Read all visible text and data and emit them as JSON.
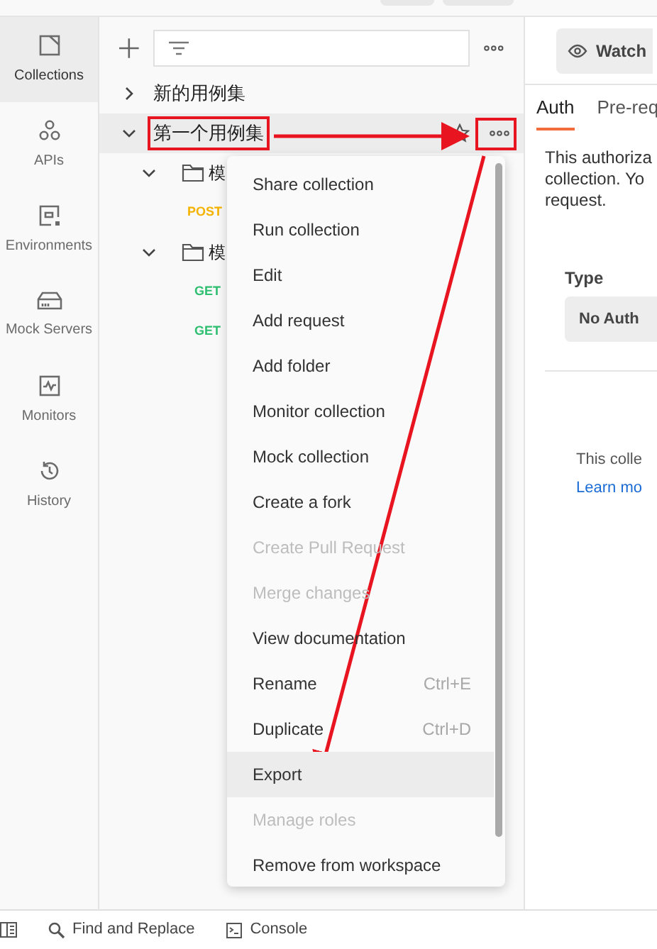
{
  "sidebar": {
    "items": [
      {
        "label": "Collections",
        "selected": true
      },
      {
        "label": "APIs",
        "selected": false
      },
      {
        "label": "Environments",
        "selected": false
      },
      {
        "label": "Mock Servers",
        "selected": false
      },
      {
        "label": "Monitors",
        "selected": false
      },
      {
        "label": "History",
        "selected": false
      }
    ]
  },
  "collections": {
    "tree": [
      {
        "kind": "collection",
        "name": "新的用例集",
        "expanded": false,
        "selected": false
      },
      {
        "kind": "collection",
        "name": "第一个用例集",
        "expanded": true,
        "selected": true,
        "children": [
          {
            "kind": "folder",
            "name": "模",
            "expanded": true,
            "children": [
              {
                "kind": "request",
                "method": "POST"
              }
            ]
          },
          {
            "kind": "folder",
            "name": "模",
            "expanded": true,
            "children": [
              {
                "kind": "request",
                "method": "GET"
              },
              {
                "kind": "request",
                "method": "GET"
              }
            ]
          }
        ]
      }
    ]
  },
  "context_menu": {
    "items": [
      {
        "label": "Share collection",
        "disabled": false,
        "selected": false
      },
      {
        "label": "Run collection",
        "disabled": false,
        "selected": false
      },
      {
        "label": "Edit",
        "disabled": false,
        "selected": false
      },
      {
        "label": "Add request",
        "disabled": false,
        "selected": false
      },
      {
        "label": "Add folder",
        "disabled": false,
        "selected": false
      },
      {
        "label": "Monitor collection",
        "disabled": false,
        "selected": false
      },
      {
        "label": "Mock collection",
        "disabled": false,
        "selected": false
      },
      {
        "label": "Create a fork",
        "disabled": false,
        "selected": false
      },
      {
        "label": "Create Pull Request",
        "disabled": true,
        "selected": false
      },
      {
        "label": "Merge changes",
        "disabled": true,
        "selected": false
      },
      {
        "label": "View documentation",
        "disabled": false,
        "selected": false
      },
      {
        "label": "Rename",
        "shortcut": "Ctrl+E",
        "disabled": false,
        "selected": false
      },
      {
        "label": "Duplicate",
        "shortcut": "Ctrl+D",
        "disabled": false,
        "selected": false
      },
      {
        "label": "Export",
        "disabled": false,
        "selected": true
      },
      {
        "label": "Manage roles",
        "disabled": true,
        "selected": false
      },
      {
        "label": "Remove from workspace",
        "disabled": false,
        "selected": false
      }
    ]
  },
  "detail": {
    "watch_button": "Watch",
    "tabs": [
      {
        "label": "Auth",
        "selected": true
      },
      {
        "label": "Pre-req",
        "selected": false
      }
    ],
    "description": [
      "This authoriza",
      "collection. Yo",
      "request."
    ],
    "type_label": "Type",
    "type_value": "No Auth",
    "note": "This colle",
    "link": "Learn mo"
  },
  "status_bar": {
    "items": [
      {
        "label": "Find and Replace"
      },
      {
        "label": "Console"
      }
    ]
  }
}
